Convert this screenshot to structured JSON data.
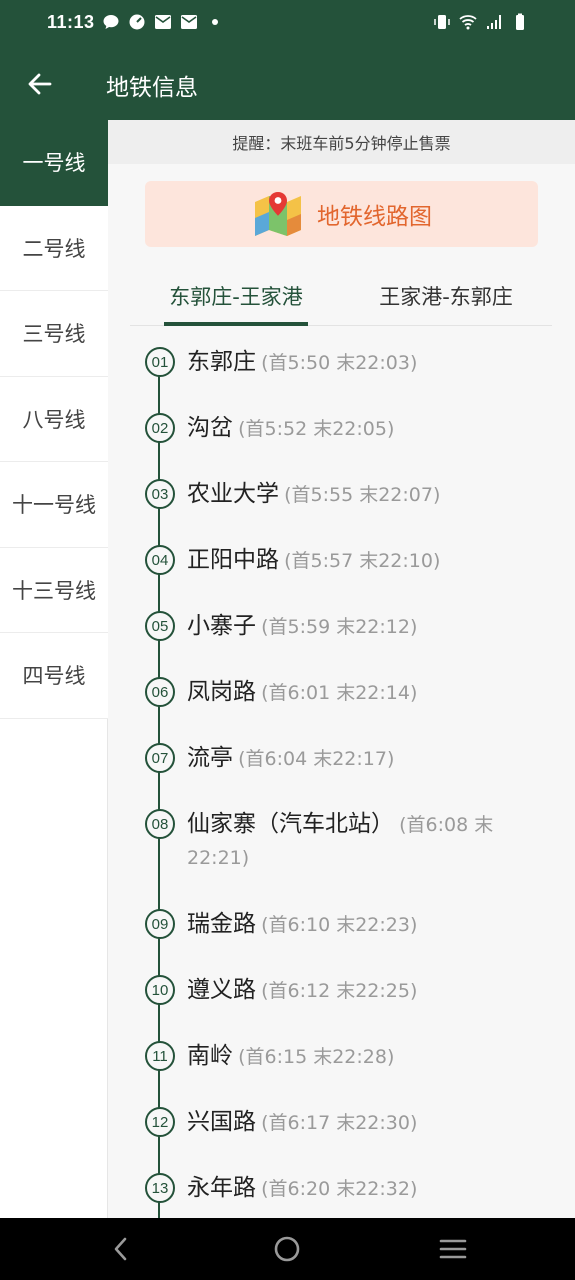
{
  "status_bar": {
    "time": "11:13",
    "left_icons": [
      "chat-icon",
      "speedometer-icon",
      "mail-icon",
      "mail-icon",
      "dot-icon"
    ],
    "right_icons": [
      "vibrate-icon",
      "wifi-icon",
      "signal-icon",
      "battery-icon"
    ]
  },
  "app_bar": {
    "title": "地铁信息"
  },
  "sidebar": {
    "items": [
      {
        "label": "一号线",
        "active": true
      },
      {
        "label": "二号线",
        "active": false
      },
      {
        "label": "三号线",
        "active": false
      },
      {
        "label": "八号线",
        "active": false
      },
      {
        "label": "十一号线",
        "active": false
      },
      {
        "label": "十三号线",
        "active": false
      },
      {
        "label": "四号线",
        "active": false
      }
    ]
  },
  "notice": "提醒：末班车前5分钟停止售票",
  "map_banner": {
    "label": "地铁线路图",
    "icon": "map-pin-icon",
    "color": "#e2662e"
  },
  "tabs": [
    {
      "label": "东郭庄-王家港",
      "active": true
    },
    {
      "label": "王家港-东郭庄",
      "active": false
    }
  ],
  "stations": [
    {
      "num": "01",
      "name": "东郭庄",
      "time": "(首5:50 末22:03)"
    },
    {
      "num": "02",
      "name": "沟岔",
      "time": "(首5:52 末22:05)"
    },
    {
      "num": "03",
      "name": "农业大学",
      "time": "(首5:55 末22:07)"
    },
    {
      "num": "04",
      "name": "正阳中路",
      "time": "(首5:57 末22:10)"
    },
    {
      "num": "05",
      "name": "小寨子",
      "time": "(首5:59 末22:12)"
    },
    {
      "num": "06",
      "name": "凤岗路",
      "time": "(首6:01 末22:14)"
    },
    {
      "num": "07",
      "name": "流亭",
      "time": "(首6:04 末22:17)"
    },
    {
      "num": "08",
      "name": "仙家寨（汽车北站）",
      "time": "(首6:08 末22:21)"
    },
    {
      "num": "09",
      "name": "瑞金路",
      "time": "(首6:10 末22:23)"
    },
    {
      "num": "10",
      "name": "遵义路",
      "time": "(首6:12 末22:25)"
    },
    {
      "num": "11",
      "name": "南岭",
      "time": "(首6:15 末22:28)"
    },
    {
      "num": "12",
      "name": "兴国路",
      "time": "(首6:17 末22:30)"
    },
    {
      "num": "13",
      "name": "永年路",
      "time": "(首6:20 末22:32)"
    }
  ],
  "colors": {
    "primary": "#24523a",
    "accent": "#e2662e",
    "banner_bg": "#fde5dc"
  },
  "nav_bar": {
    "buttons": [
      "back-icon",
      "home-icon",
      "recents-icon"
    ]
  }
}
